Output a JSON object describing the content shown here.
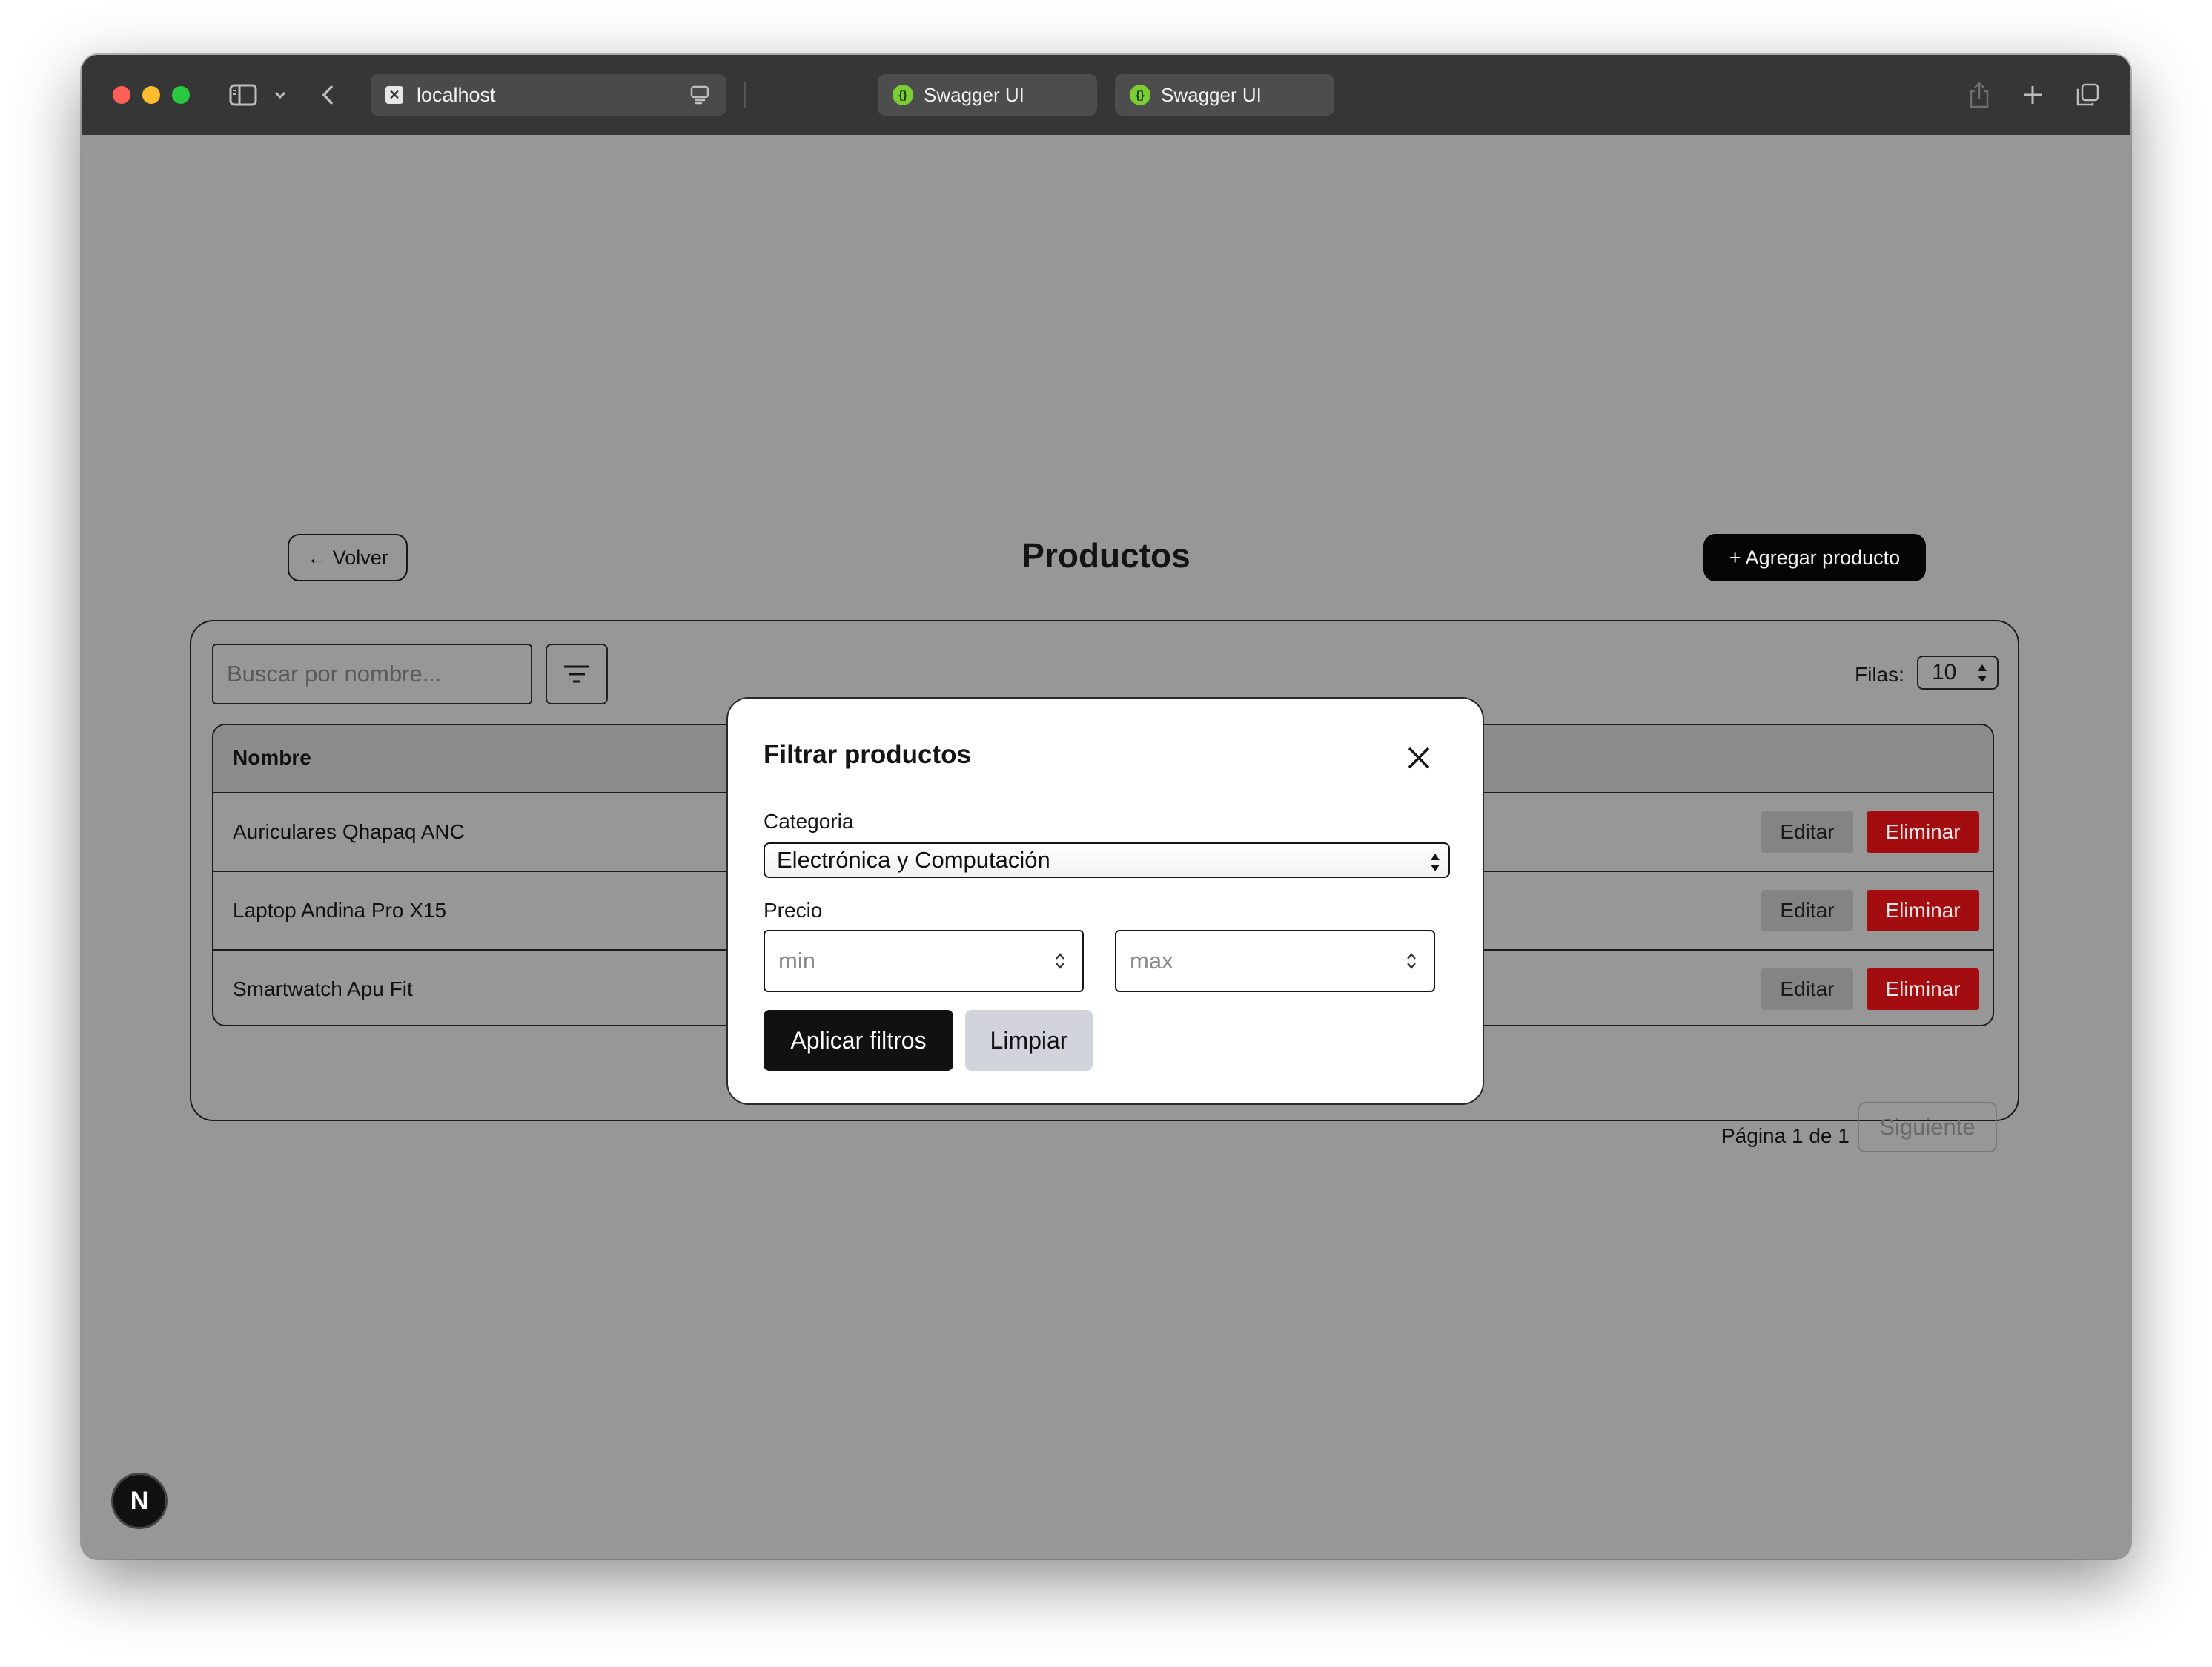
{
  "browser": {
    "url": "localhost",
    "tabs": [
      {
        "label": "Swagger UI"
      },
      {
        "label": "Swagger UI"
      }
    ]
  },
  "page": {
    "back_label": "← Volver",
    "title": "Productos",
    "add_label": "+ Agregar producto",
    "search_placeholder": "Buscar por nombre...",
    "rows_label": "Filas:",
    "rows_value": "10",
    "table": {
      "header_name": "Nombre",
      "rows": [
        {
          "name": "Auriculares Qhapaq ANC",
          "edit": "Editar",
          "delete": "Eliminar"
        },
        {
          "name": "Laptop Andina Pro X15",
          "edit": "Editar",
          "delete": "Eliminar"
        },
        {
          "name": "Smartwatch Apu Fit",
          "edit": "Editar",
          "delete": "Eliminar"
        }
      ]
    },
    "pagination": {
      "info": "Página 1 de 1",
      "next_label": "Siguiente"
    }
  },
  "modal": {
    "title": "Filtrar productos",
    "category_label": "Categoria",
    "category_value": "Electrónica y Computación",
    "price_label": "Precio",
    "min_placeholder": "min",
    "max_placeholder": "max",
    "apply_label": "Aplicar filtros",
    "clear_label": "Limpiar"
  },
  "dev_badge": {
    "letter": "N"
  },
  "colors": {
    "delete_button": "#a30d0f",
    "primary_button": "#111111",
    "clear_button": "#d1d5db",
    "overlay_background": "#979797"
  }
}
